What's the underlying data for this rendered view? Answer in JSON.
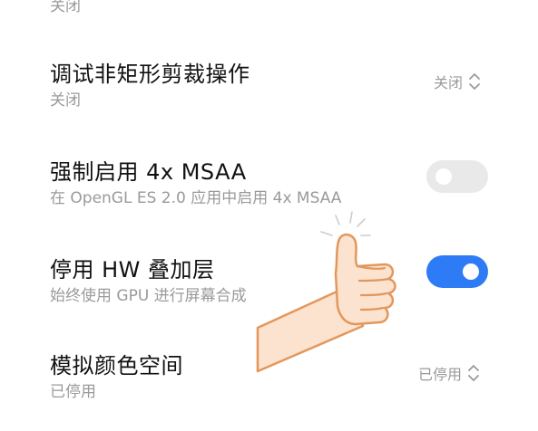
{
  "top_partial": {
    "text": "关闭"
  },
  "settings": [
    {
      "title": "调试非矩形剪裁操作",
      "subtitle": "关闭",
      "value": "关闭"
    },
    {
      "title": "强制启用 4x MSAA",
      "subtitle": "在 OpenGL ES 2.0 应用中启用 4x MSAA",
      "toggle": false
    },
    {
      "title": "停用 HW 叠加层",
      "subtitle": "始终使用 GPU 进行屏幕合成",
      "toggle": true
    },
    {
      "title": "模拟颜色空间",
      "subtitle": "已停用",
      "value": "已停用"
    }
  ],
  "colors": {
    "toggle_on": "#2e7bf6",
    "toggle_off": "#e9e9e9",
    "title": "#111111",
    "subtitle": "#9a9a9a"
  },
  "icons": {
    "dropdown": "chevron-up-down-icon",
    "overlay": "thumbs-up-icon"
  }
}
